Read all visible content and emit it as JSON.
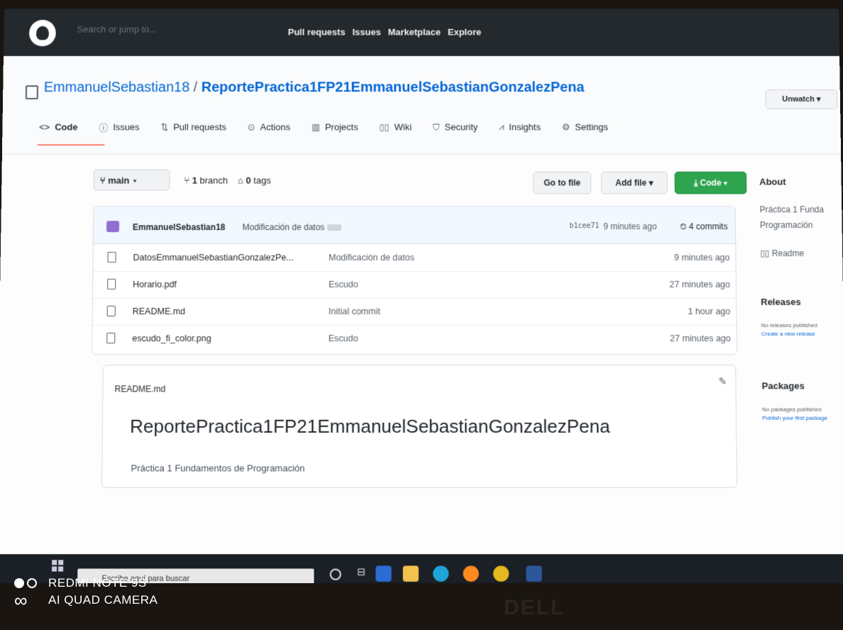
{
  "header": {
    "search_placeholder": "Search or jump to...",
    "nav": [
      "Pull requests",
      "Issues",
      "Marketplace",
      "Explore"
    ]
  },
  "repo": {
    "owner": "EmmanuelSebastian18",
    "separator": "/",
    "name": "ReportePractica1FP21EmmanuelSebastianGonzalezPena",
    "watch_label": "Unwatch ▾"
  },
  "tabs": [
    {
      "icon": "<>",
      "label": "Code"
    },
    {
      "icon": "ⓘ",
      "label": "Issues"
    },
    {
      "icon": "⇅",
      "label": "Pull requests"
    },
    {
      "icon": "⊙",
      "label": "Actions"
    },
    {
      "icon": "▥",
      "label": "Projects"
    },
    {
      "icon": "▯▯",
      "label": "Wiki"
    },
    {
      "icon": "⛉",
      "label": "Security"
    },
    {
      "icon": "⩘",
      "label": "Insights"
    },
    {
      "icon": "⚙",
      "label": "Settings"
    }
  ],
  "branch": {
    "current": "main",
    "branch_count": "1",
    "branch_label": "branch",
    "tag_count": "0",
    "tag_label": "tags"
  },
  "buttons": {
    "go_to_file": "Go to file",
    "add_file": "Add file ▾",
    "code": "⤓ Code ▾"
  },
  "commit": {
    "user": "EmmanuelSebastian18",
    "message": "Modificación de datos",
    "hash": "b1cee71",
    "time": "9 minutes ago",
    "count": "4 commits"
  },
  "files": [
    {
      "name": "DatosEmmanuelSebastianGonzalezPe...",
      "message": "Modificación de datos",
      "time": "9 minutes ago"
    },
    {
      "name": "Horario.pdf",
      "message": "Escudo",
      "time": "27 minutes ago"
    },
    {
      "name": "README.md",
      "message": "Initial commit",
      "time": "1 hour ago"
    },
    {
      "name": "escudo_fi_color.png",
      "message": "Escudo",
      "time": "27 minutes ago"
    }
  ],
  "readme": {
    "file": "README.md",
    "heading": "ReportePractica1FP21EmmanuelSebastianGonzalezPena",
    "body": "Práctica 1 Fundamentos de Programación"
  },
  "sidebar": {
    "about_title": "About",
    "about_line1": "Práctica 1 Funda",
    "about_line2": "Programación",
    "readme_link": "Readme",
    "releases_title": "Releases",
    "releases_none": "No releases published",
    "releases_create": "Create a new release",
    "packages_title": "Packages",
    "packages_none": "No packages published",
    "packages_publish": "Publish your first package"
  },
  "taskbar": {
    "search_placeholder": "Escribe aquí para buscar"
  },
  "watermark": {
    "line1": "REDMI NOTE 9S",
    "line2": "AI QUAD CAMERA",
    "monitor_brand": "DELL"
  },
  "colors": {
    "header_bg": "#24292e",
    "link": "#0366d6",
    "code_button": "#2ea44f",
    "active_tab_underline": "#f9826c"
  }
}
